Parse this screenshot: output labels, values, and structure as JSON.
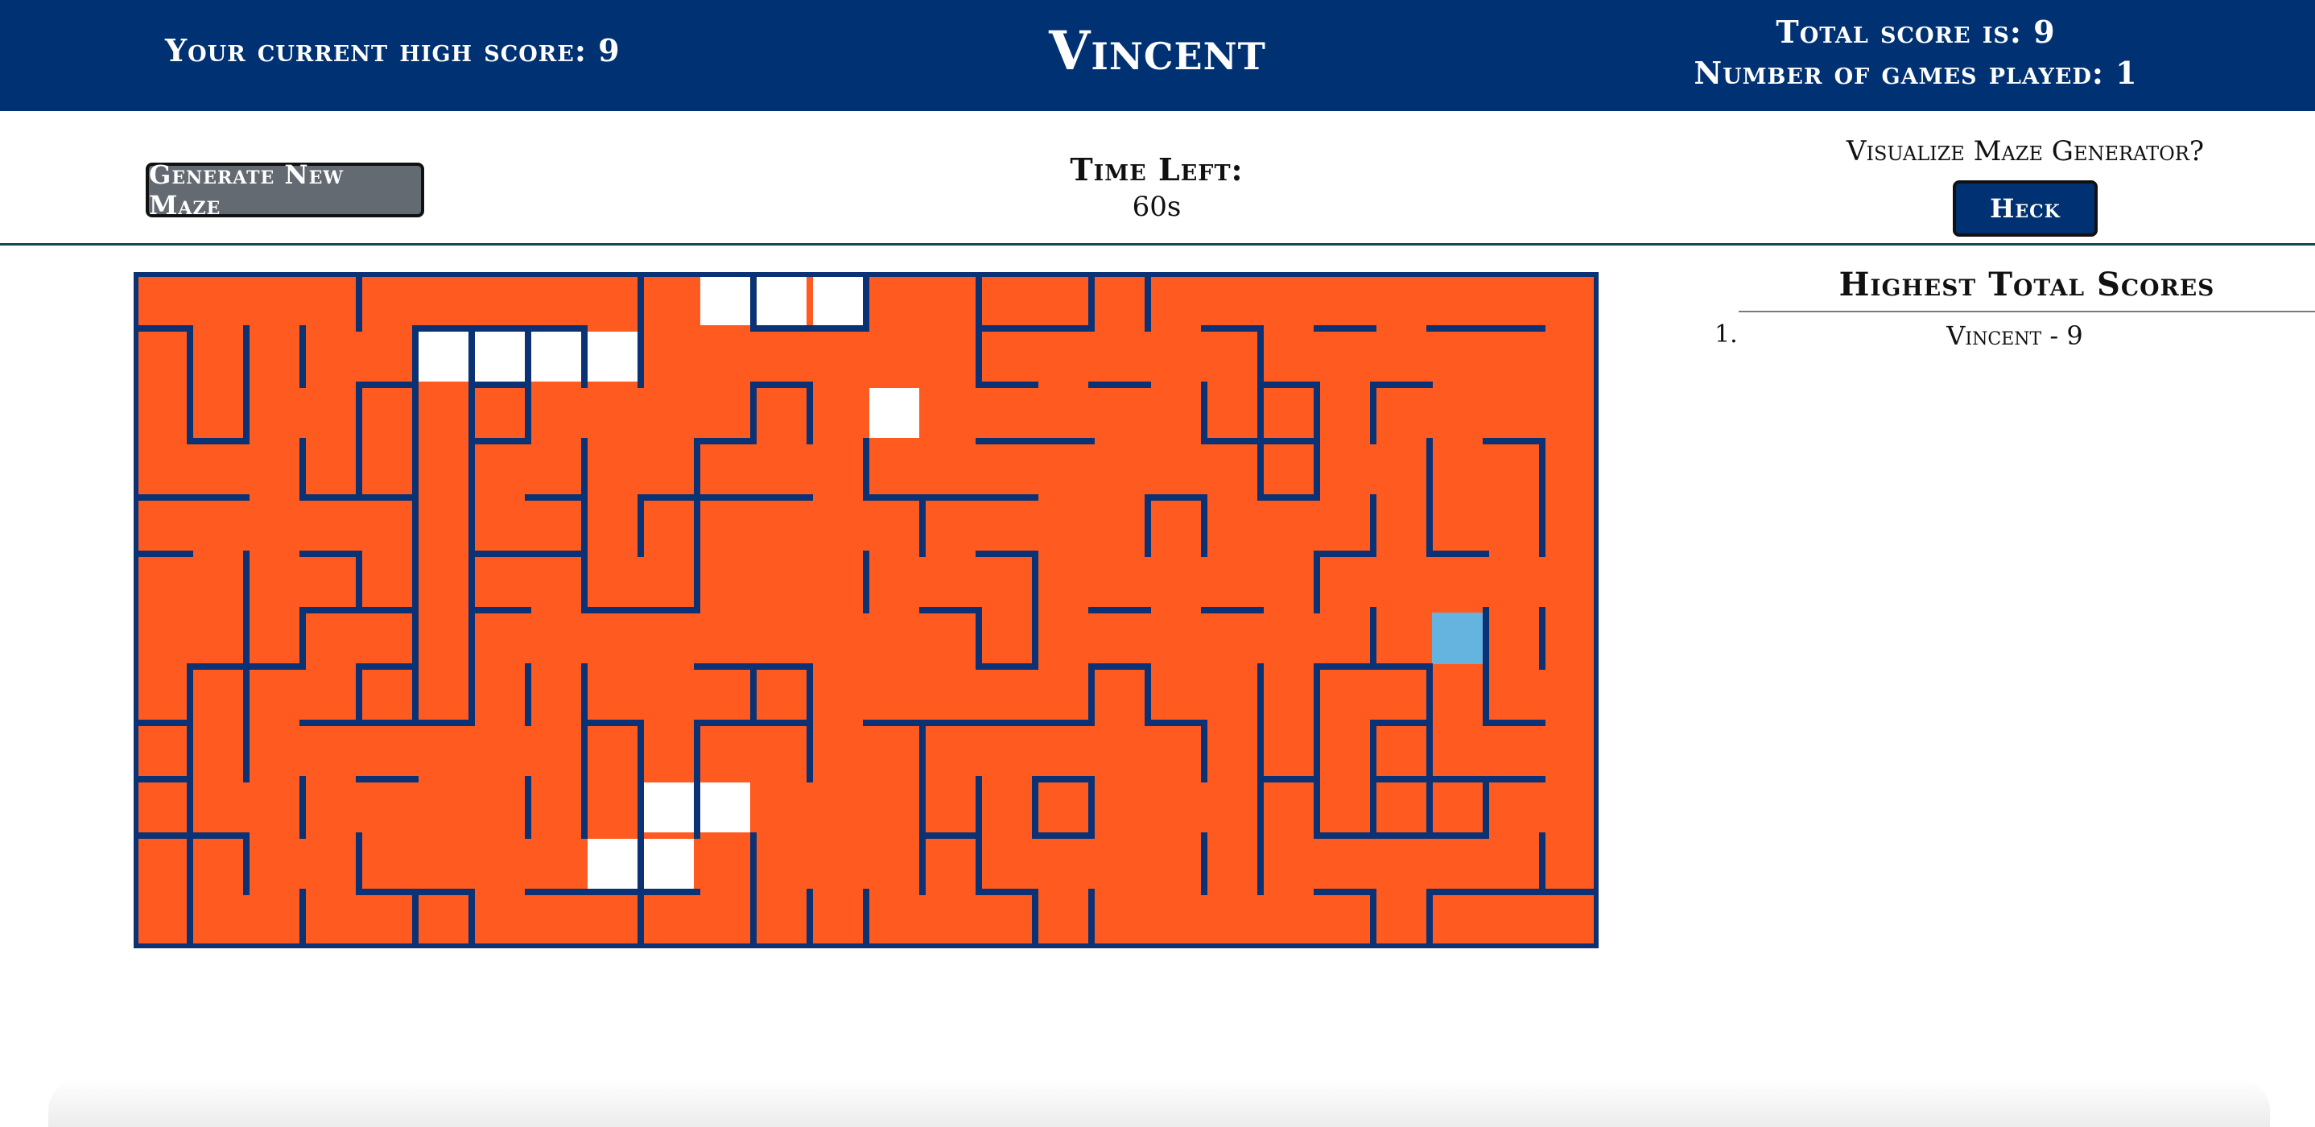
{
  "header": {
    "high_score": "Your current high score: 9",
    "username": "Vincent",
    "total_score": "Total score is: 9",
    "games_played": "Number of games played: 1"
  },
  "controls": {
    "generate_label": "Generate New Maze",
    "time_label": "Time Left:",
    "time_value": "60s",
    "visualize_question": "Visualize Maze Generator?",
    "visualize_button": "Heck Yes!"
  },
  "leaderboard": {
    "title": "Highest Total Scores",
    "entries": [
      {
        "rank": "1.",
        "text": "Vincent - 9"
      }
    ]
  },
  "maze": {
    "cols": 26,
    "rows": 12,
    "colors": {
      "path": "#ff5a1f",
      "wall": "#0a3274",
      "visited": "#ffffff",
      "player": "#65b4e0"
    },
    "visited_cells": [
      [
        10,
        0
      ],
      [
        11,
        0
      ],
      [
        12,
        0
      ],
      [
        5,
        1
      ],
      [
        6,
        1
      ],
      [
        7,
        1
      ],
      [
        8,
        1
      ],
      [
        13,
        2
      ],
      [
        9,
        9
      ],
      [
        10,
        9
      ],
      [
        8,
        10
      ],
      [
        9,
        10
      ]
    ],
    "player_cell": [
      23,
      6
    ]
  }
}
